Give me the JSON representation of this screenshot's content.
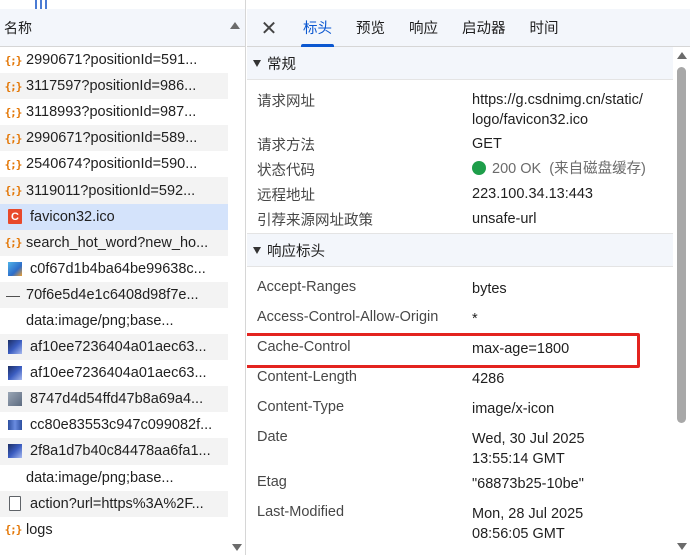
{
  "list": {
    "header": "名称",
    "rows": [
      {
        "icon": "json",
        "name": "2990671?positionId=591..."
      },
      {
        "icon": "json",
        "name": "3117597?positionId=986..."
      },
      {
        "icon": "json",
        "name": "3118993?positionId=987..."
      },
      {
        "icon": "json",
        "name": "2990671?positionId=589..."
      },
      {
        "icon": "json",
        "name": "2540674?positionId=590..."
      },
      {
        "icon": "json",
        "name": "3119011?positionId=592..."
      },
      {
        "icon": "favicon",
        "name": "favicon32.ico"
      },
      {
        "icon": "json",
        "name": "search_hot_word?new_ho..."
      },
      {
        "icon": "image",
        "name": "c0f67d1b4ba64be99638c..."
      },
      {
        "icon": "dash",
        "name": "70f6e5d4e1c6408d98f7e..."
      },
      {
        "icon": "none",
        "name": "data:image/png;base..."
      },
      {
        "icon": "image",
        "name": "af10ee7236404a01aec63..."
      },
      {
        "icon": "image",
        "name": "af10ee7236404a01aec63..."
      },
      {
        "icon": "image",
        "name": "8747d4d54ffd47b8a69a4..."
      },
      {
        "icon": "image",
        "name": "cc80e83553c947c099082f..."
      },
      {
        "icon": "image",
        "name": "2f8a1d7b40c84478aa6fa1..."
      },
      {
        "icon": "none",
        "name": "data:image/png;base..."
      },
      {
        "icon": "document",
        "name": "action?url=https%3A%2F..."
      },
      {
        "icon": "json",
        "name": "logs"
      }
    ],
    "selected_index": 6
  },
  "tabs": {
    "close_label": "✕",
    "items": [
      "标头",
      "预览",
      "响应",
      "启动器",
      "时间"
    ],
    "active_index": 0
  },
  "general": {
    "title": "常规",
    "request_url_label": "请求网址",
    "request_url_line1": "https://g.csdnimg.cn/static/",
    "request_url_line2": "logo/favicon32.ico",
    "method_label": "请求方法",
    "method_value": "GET",
    "status_label": "状态代码",
    "status_value": "200 OK",
    "status_note": "(来自磁盘缓存)",
    "remote_label": "远程地址",
    "remote_value": "223.100.34.13:443",
    "referrer_label": "引荐来源网址政策",
    "referrer_value": "unsafe-url"
  },
  "response_headers": {
    "title": "响应标头",
    "accept_ranges_k": "Accept-Ranges",
    "accept_ranges_v": "bytes",
    "acao_k": "Access-Control-Allow-Origin",
    "acao_v": "*",
    "cache_control_k": "Cache-Control",
    "cache_control_v": "max-age=1800",
    "content_length_k": "Content-Length",
    "content_length_v": "4286",
    "content_type_k": "Content-Type",
    "content_type_v": "image/x-icon",
    "date_k": "Date",
    "date_v1": "Wed, 30 Jul 2025",
    "date_v2": "13:55:14 GMT",
    "etag_k": "Etag",
    "etag_v": "\"68873b25-10be\"",
    "last_modified_k": "Last-Modified",
    "last_modified_v1": "Mon, 28 Jul 2025",
    "last_modified_v2": "08:56:05 GMT"
  },
  "colors": {
    "accent": "#0b57d0",
    "selected_row": "#d4e3fb",
    "highlight_box": "#e3231f",
    "status_ok": "#1e9e4a"
  }
}
